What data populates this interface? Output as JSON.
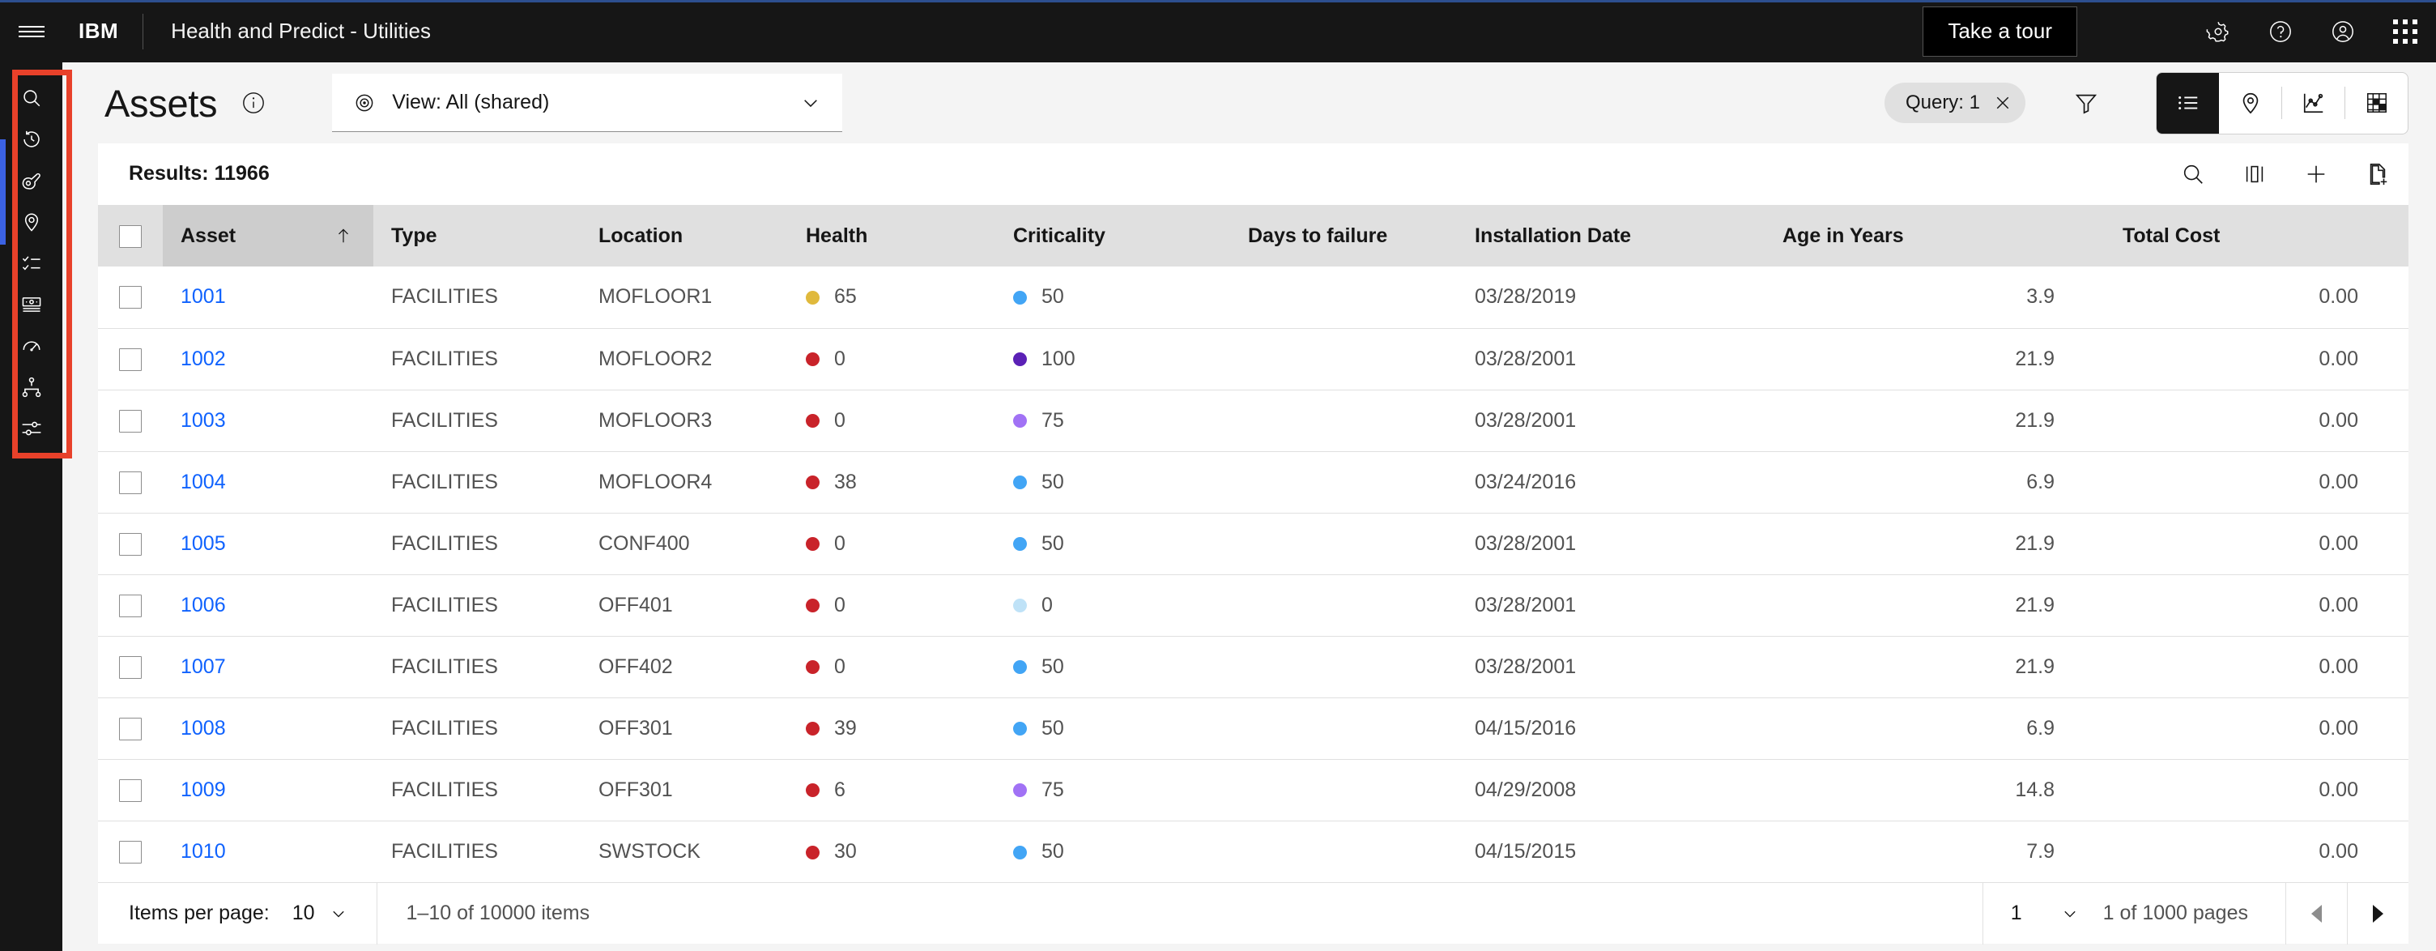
{
  "header": {
    "menu_icon": "hamburger-menu-icon",
    "brand": "IBM",
    "app_name": "Health and Predict - Utilities",
    "tour_button": "Take a tour",
    "icons": [
      "gear-icon",
      "help-icon",
      "user-avatar-icon",
      "app-switcher-icon"
    ]
  },
  "sidebar": {
    "items": [
      {
        "name": "search-icon",
        "label": "Search"
      },
      {
        "name": "history-icon",
        "label": "Recent"
      },
      {
        "name": "asset-icon",
        "label": "Assets"
      },
      {
        "name": "location-pin-icon",
        "label": "Locations"
      },
      {
        "name": "checklist-icon",
        "label": "Work Orders"
      },
      {
        "name": "meter-icon",
        "label": "Meters"
      },
      {
        "name": "gauge-icon",
        "label": "Health"
      },
      {
        "name": "hierarchy-icon",
        "label": "Hierarchy"
      },
      {
        "name": "sliders-icon",
        "label": "Settings"
      }
    ],
    "highlight_color": "#e8412a",
    "scroll_indicator_color": "#3b62e3"
  },
  "page": {
    "title": "Assets",
    "info_icon": "info-icon",
    "view_selector": {
      "icon": "view-eye-icon",
      "value": "View: All (shared)",
      "chevron": "chevron-down-icon"
    },
    "query_tag": {
      "label": "Query: 1",
      "close_icon": "close-icon"
    },
    "filter_icon": "filter-icon",
    "view_toggle": [
      {
        "name": "list-view-button",
        "icon": "list-icon",
        "active": true
      },
      {
        "name": "map-view-button",
        "icon": "map-pin-icon",
        "active": false
      },
      {
        "name": "chart-view-button",
        "icon": "chart-icon",
        "active": false
      },
      {
        "name": "grid-view-button",
        "icon": "grid-table-icon",
        "active": false
      }
    ]
  },
  "toolbar": {
    "results_label": "Results: 11966",
    "actions": [
      {
        "name": "search-button",
        "icon": "search-icon"
      },
      {
        "name": "column-settings-button",
        "icon": "columns-icon"
      },
      {
        "name": "add-button",
        "icon": "plus-icon"
      },
      {
        "name": "new-document-button",
        "icon": "document-add-icon"
      }
    ]
  },
  "table": {
    "columns": [
      {
        "key": "asset",
        "label": "Asset",
        "sorted": true,
        "sort_dir": "asc",
        "align": "left"
      },
      {
        "key": "type",
        "label": "Type",
        "sorted": false,
        "align": "left"
      },
      {
        "key": "location",
        "label": "Location",
        "sorted": false,
        "align": "left"
      },
      {
        "key": "health",
        "label": "Health",
        "sorted": false,
        "align": "left"
      },
      {
        "key": "criticality",
        "label": "Criticality",
        "sorted": false,
        "align": "left"
      },
      {
        "key": "days_to_failure",
        "label": "Days to failure",
        "sorted": false,
        "align": "left"
      },
      {
        "key": "installation_date",
        "label": "Installation Date",
        "sorted": false,
        "align": "left"
      },
      {
        "key": "age_in_years",
        "label": "Age in Years",
        "sorted": false,
        "align": "right"
      },
      {
        "key": "total_cost",
        "label": "Total Cost",
        "sorted": false,
        "align": "right"
      }
    ],
    "rows": [
      {
        "asset": "1001",
        "type": "FACILITIES",
        "location": "MOFLOOR1",
        "health": "65",
        "health_color": "#e0b93c",
        "criticality": "50",
        "criticality_color": "#42a5f5",
        "days_to_failure": "",
        "installation_date": "03/28/2019",
        "age_in_years": "3.9",
        "total_cost": "0.00"
      },
      {
        "asset": "1002",
        "type": "FACILITIES",
        "location": "MOFLOOR2",
        "health": "0",
        "health_color": "#c9232a",
        "criticality": "100",
        "criticality_color": "#5b21b6",
        "days_to_failure": "",
        "installation_date": "03/28/2001",
        "age_in_years": "21.9",
        "total_cost": "0.00"
      },
      {
        "asset": "1003",
        "type": "FACILITIES",
        "location": "MOFLOOR3",
        "health": "0",
        "health_color": "#c9232a",
        "criticality": "75",
        "criticality_color": "#a172f5",
        "days_to_failure": "",
        "installation_date": "03/28/2001",
        "age_in_years": "21.9",
        "total_cost": "0.00"
      },
      {
        "asset": "1004",
        "type": "FACILITIES",
        "location": "MOFLOOR4",
        "health": "38",
        "health_color": "#c9232a",
        "criticality": "50",
        "criticality_color": "#42a5f5",
        "days_to_failure": "",
        "installation_date": "03/24/2016",
        "age_in_years": "6.9",
        "total_cost": "0.00"
      },
      {
        "asset": "1005",
        "type": "FACILITIES",
        "location": "CONF400",
        "health": "0",
        "health_color": "#c9232a",
        "criticality": "50",
        "criticality_color": "#42a5f5",
        "days_to_failure": "",
        "installation_date": "03/28/2001",
        "age_in_years": "21.9",
        "total_cost": "0.00"
      },
      {
        "asset": "1006",
        "type": "FACILITIES",
        "location": "OFF401",
        "health": "0",
        "health_color": "#c9232a",
        "criticality": "0",
        "criticality_color": "#bfe2f7",
        "days_to_failure": "",
        "installation_date": "03/28/2001",
        "age_in_years": "21.9",
        "total_cost": "0.00"
      },
      {
        "asset": "1007",
        "type": "FACILITIES",
        "location": "OFF402",
        "health": "0",
        "health_color": "#c9232a",
        "criticality": "50",
        "criticality_color": "#42a5f5",
        "days_to_failure": "",
        "installation_date": "03/28/2001",
        "age_in_years": "21.9",
        "total_cost": "0.00"
      },
      {
        "asset": "1008",
        "type": "FACILITIES",
        "location": "OFF301",
        "health": "39",
        "health_color": "#c9232a",
        "criticality": "50",
        "criticality_color": "#42a5f5",
        "days_to_failure": "",
        "installation_date": "04/15/2016",
        "age_in_years": "6.9",
        "total_cost": "0.00"
      },
      {
        "asset": "1009",
        "type": "FACILITIES",
        "location": "OFF301",
        "health": "6",
        "health_color": "#c9232a",
        "criticality": "75",
        "criticality_color": "#a172f5",
        "days_to_failure": "",
        "installation_date": "04/29/2008",
        "age_in_years": "14.8",
        "total_cost": "0.00"
      },
      {
        "asset": "1010",
        "type": "FACILITIES",
        "location": "SWSTOCK",
        "health": "30",
        "health_color": "#c9232a",
        "criticality": "50",
        "criticality_color": "#42a5f5",
        "days_to_failure": "",
        "installation_date": "04/15/2015",
        "age_in_years": "7.9",
        "total_cost": "0.00"
      }
    ]
  },
  "pagination": {
    "items_per_page_label": "Items per page:",
    "items_per_page_value": "10",
    "range_text": "1–10 of 10000 items",
    "page_value": "1",
    "page_total_text": "1 of 1000 pages",
    "prev_icon": "caret-left-icon",
    "next_icon": "caret-right-icon"
  }
}
